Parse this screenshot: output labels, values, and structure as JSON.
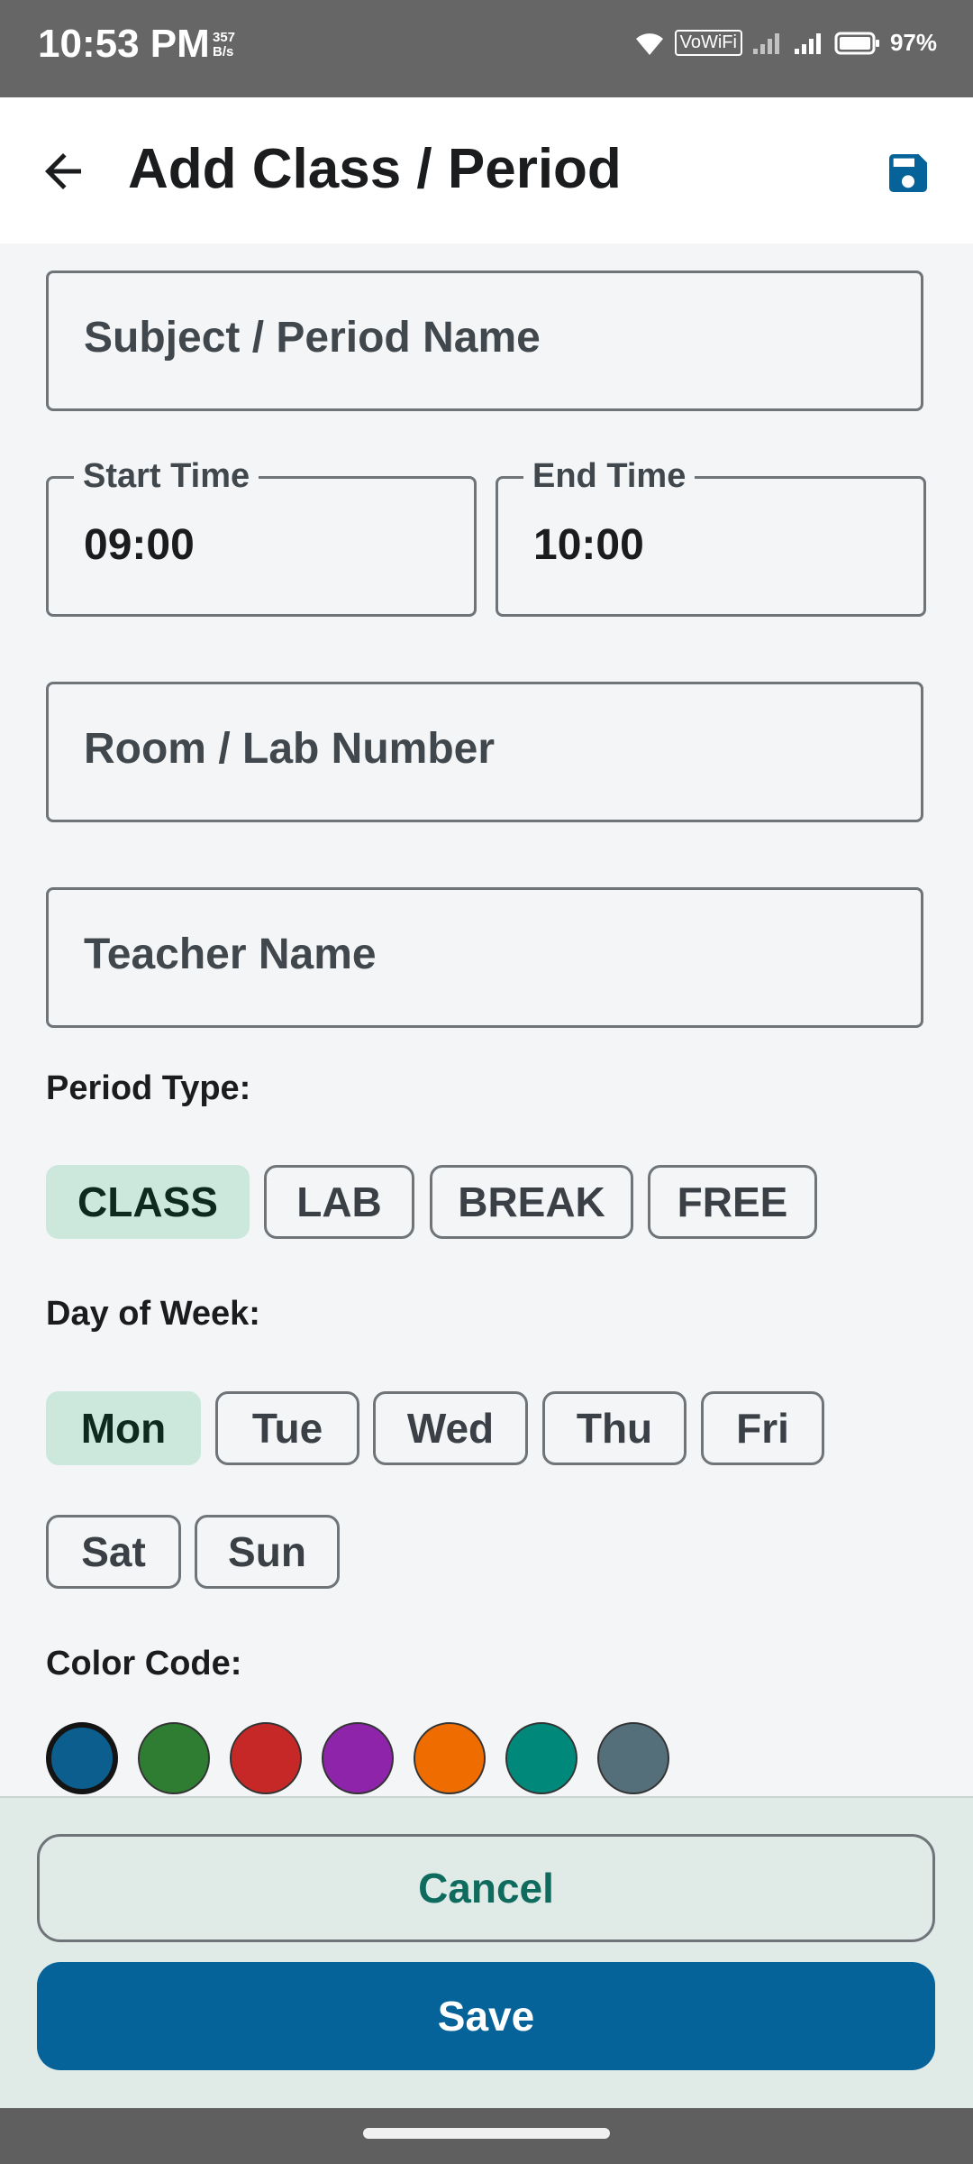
{
  "status_bar": {
    "time": "10:53 PM",
    "net_speed_value": "357",
    "net_speed_unit": "B/s",
    "vowifi": "VoWiFi",
    "battery": "97%"
  },
  "app_bar": {
    "title": "Add Class / Period"
  },
  "form": {
    "subject_placeholder": "Subject / Period Name",
    "start_time_label": "Start Time",
    "start_time_value": "09:00",
    "end_time_label": "End Time",
    "end_time_value": "10:00",
    "room_placeholder": "Room / Lab Number",
    "teacher_placeholder": "Teacher Name"
  },
  "period_type": {
    "label": "Period Type:",
    "options": [
      "CLASS",
      "LAB",
      "BREAK",
      "FREE"
    ],
    "selected": "CLASS"
  },
  "day_of_week": {
    "label": "Day of Week:",
    "options": [
      "Mon",
      "Tue",
      "Wed",
      "Thu",
      "Fri",
      "Sat",
      "Sun"
    ],
    "selected": "Mon"
  },
  "color_code": {
    "label": "Color Code:",
    "colors": [
      "#0b5e8e",
      "#2e7d32",
      "#c62828",
      "#8e24aa",
      "#ef6c00",
      "#00897b",
      "#546e7a"
    ],
    "selected_index": 0
  },
  "actions": {
    "cancel_label": "Cancel",
    "save_label": "Save"
  },
  "theme": {
    "primary": "#066399",
    "selected_chip": "#cce8dc"
  }
}
